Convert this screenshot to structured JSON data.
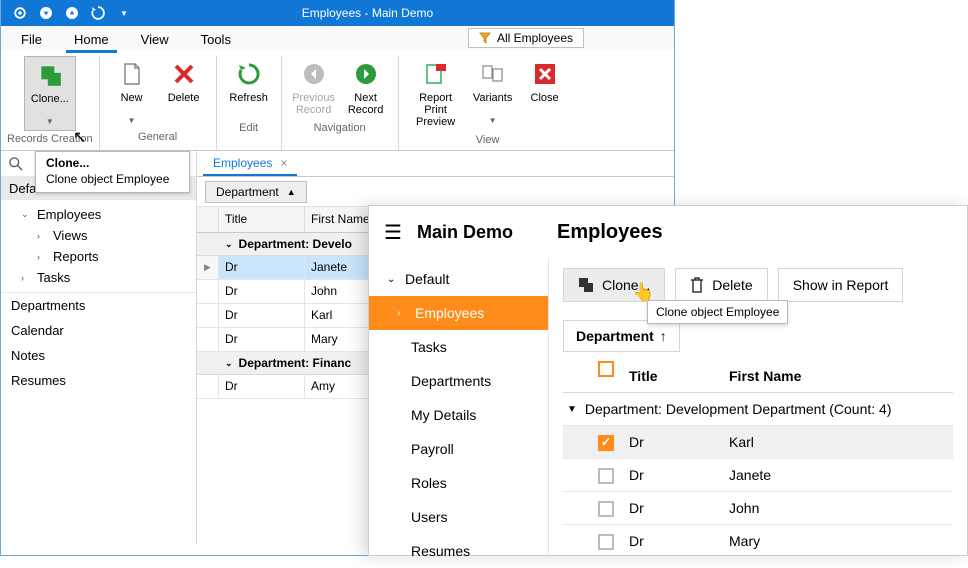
{
  "win": {
    "title": "Employees - Main Demo",
    "menus": {
      "file": "File",
      "home": "Home",
      "view": "View",
      "tools": "Tools"
    },
    "filter": "All Employees",
    "ribbon": {
      "clone": "Clone...",
      "new": "New",
      "delete": "Delete",
      "refresh": "Refresh",
      "prev": "Previous Record",
      "next": "Next Record",
      "report": "Report Print Preview",
      "variants": "Variants",
      "close": "Close",
      "g_records": "Records Creation",
      "g_general": "General",
      "g_edit": "Edit",
      "g_nav": "Navigation",
      "g_view": "View"
    },
    "tooltip": {
      "head": "Clone...",
      "body": "Clone object Employee"
    },
    "panel_head": "Default",
    "tree": {
      "employees": "Employees",
      "views": "Views",
      "reports": "Reports",
      "tasks": "Tasks"
    },
    "flat": {
      "departments": "Departments",
      "calendar": "Calendar",
      "notes": "Notes",
      "resumes": "Resumes"
    },
    "tab": "Employees",
    "sort": "Department",
    "cols": {
      "title": "Title",
      "first_name": "First Name"
    },
    "groups": {
      "dev": "Department: Develo",
      "fin": "Department: Financ"
    },
    "rows": {
      "dev": [
        {
          "title": "Dr",
          "first": "Janete"
        },
        {
          "title": "Dr",
          "first": "John"
        },
        {
          "title": "Dr",
          "first": "Karl"
        },
        {
          "title": "Dr",
          "first": "Mary"
        }
      ],
      "fin": [
        {
          "title": "Dr",
          "first": "Amy"
        }
      ]
    }
  },
  "web": {
    "title": "Main Demo",
    "page": "Employees",
    "side": {
      "root": "Default",
      "employees": "Employees",
      "tasks": "Tasks",
      "departments": "Departments",
      "mydetails": "My Details",
      "payroll": "Payroll",
      "roles": "Roles",
      "users": "Users",
      "resumes": "Resumes"
    },
    "btns": {
      "clone": "Clone...",
      "delete": "Delete",
      "show": "Show in Report"
    },
    "tooltip": "Clone object Employee",
    "chip": "Department",
    "cols": {
      "title": "Title",
      "first_name": "First Name"
    },
    "group": "Department: Development Department (Count: 4)",
    "rows": [
      {
        "title": "Dr",
        "first": "Karl",
        "checked": true
      },
      {
        "title": "Dr",
        "first": "Janete",
        "checked": false
      },
      {
        "title": "Dr",
        "first": "John",
        "checked": false
      },
      {
        "title": "Dr",
        "first": "Mary",
        "checked": false
      }
    ]
  }
}
